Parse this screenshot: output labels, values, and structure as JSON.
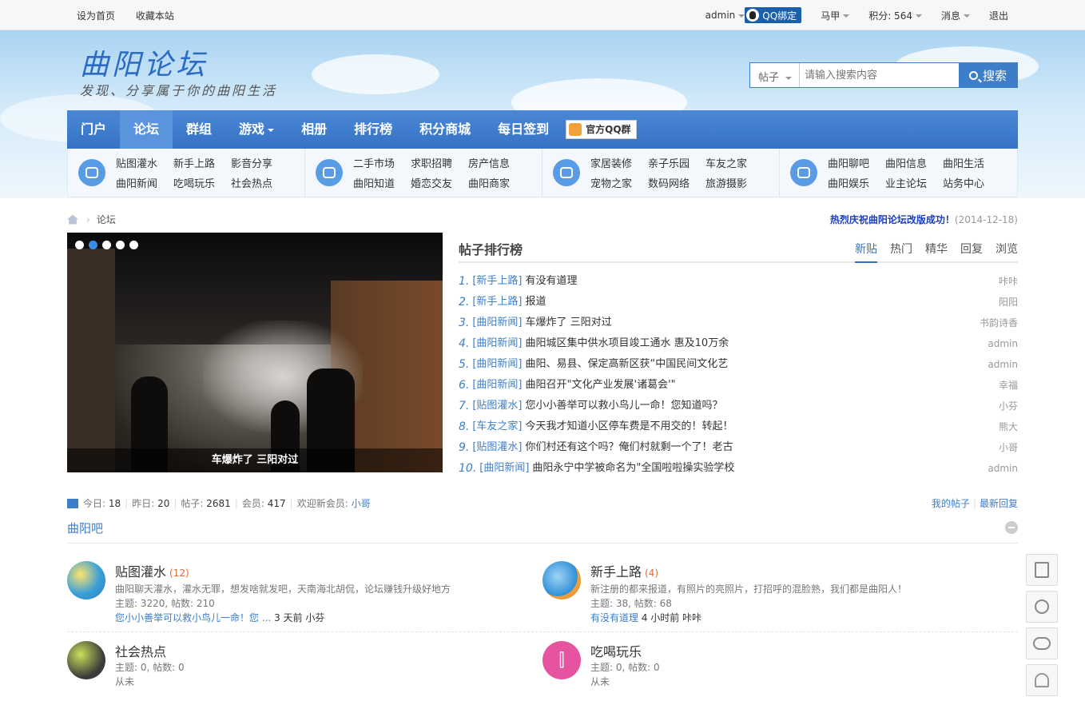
{
  "topbar": {
    "set_home": "设为首页",
    "bookmark": "收藏本站",
    "user": "admin",
    "qq_bind": "QQ绑定",
    "user_name": "马甲",
    "points": "积分: 564",
    "messages": "消息",
    "logout": "退出"
  },
  "header": {
    "logo": "曲阳论坛",
    "slogan": "发现、分享属于你的曲阳生活",
    "search_type": "帖子",
    "search_placeholder": "请输入搜索内容",
    "search_button": "搜索"
  },
  "nav": {
    "items": [
      "门户",
      "论坛",
      "群组",
      "游戏",
      "相册",
      "排行榜",
      "积分商城",
      "每日签到"
    ],
    "qq_group": "官方QQ群",
    "active": "论坛"
  },
  "subnav": [
    {
      "icon": "chat-icon",
      "links": [
        "贴图灌水",
        "新手上路",
        "影音分享",
        "曲阳新闻",
        "吃喝玩乐",
        "社会热点"
      ]
    },
    {
      "icon": "home-icon",
      "links": [
        "二手市场",
        "求职招聘",
        "房产信息",
        "曲阳知道",
        "婚恋交友",
        "曲阳商家"
      ]
    },
    {
      "icon": "tablet-icon",
      "links": [
        "家居装修",
        "亲子乐园",
        "车友之家",
        "宠物之家",
        "数码网络",
        "旅游摄影"
      ]
    },
    {
      "icon": "star-icon",
      "links": [
        "曲阳聊吧",
        "曲阳信息",
        "曲阳生活",
        "曲阳娱乐",
        "业主论坛",
        "站务中心"
      ]
    }
  ],
  "breadcrumb": {
    "current": "论坛"
  },
  "notice": {
    "text": "热烈庆祝曲阳论坛改版成功！",
    "date": "(2014-12-18)"
  },
  "slider": {
    "caption": "车爆炸了 三阳对过",
    "dot_count": 5,
    "active_dot": 2
  },
  "rank": {
    "title": "帖子排行榜",
    "tabs": [
      "新贴",
      "热门",
      "精华",
      "回复",
      "浏览"
    ],
    "active_tab": "新贴",
    "items": [
      {
        "num": "1.",
        "cat": "[新手上路]",
        "title": "有没有道理",
        "author": "咔咔"
      },
      {
        "num": "2.",
        "cat": "[新手上路]",
        "title": "报道",
        "author": "阳阳"
      },
      {
        "num": "3.",
        "cat": "[曲阳新闻]",
        "title": "车爆炸了 三阳对过",
        "author": "书韵诗香"
      },
      {
        "num": "4.",
        "cat": "[曲阳新闻]",
        "title": "曲阳城区集中供水项目竣工通水 惠及10万余",
        "author": "admin"
      },
      {
        "num": "5.",
        "cat": "[曲阳新闻]",
        "title": "曲阳、易县、保定高新区获“中国民间文化艺",
        "author": "admin"
      },
      {
        "num": "6.",
        "cat": "[曲阳新闻]",
        "title": "曲阳召开\"文化产业发展'诸葛会'\"",
        "author": "幸福"
      },
      {
        "num": "7.",
        "cat": "[贴图灌水]",
        "title": "您小小善举可以救小鸟儿一命！您知道吗？",
        "author": "小芬"
      },
      {
        "num": "8.",
        "cat": "[车友之家]",
        "title": "今天我才知道小区停车费是不用交的！转起！",
        "author": "熊大"
      },
      {
        "num": "9.",
        "cat": "[贴图灌水]",
        "title": "你们村还有这个吗？俺们村就剩一个了！老古",
        "author": "小哥"
      },
      {
        "num": "10.",
        "cat": "[曲阳新闻]",
        "title": "曲阳永宁中学被命名为\"全国啦啦操实验学校",
        "author": "admin"
      }
    ]
  },
  "stats": {
    "today_label": "今日:",
    "today": "18",
    "yesterday_label": "昨日:",
    "yesterday": "20",
    "posts_label": "帖子:",
    "posts": "2681",
    "members_label": "会员:",
    "members": "417",
    "welcome_label": "欢迎新会员:",
    "newest": "小哥"
  },
  "mylinks": {
    "my_posts": "我的帖子",
    "latest": "最新回复"
  },
  "section": {
    "title": "曲阳吧"
  },
  "forums": [
    {
      "name": "贴图灌水",
      "today": "(12)",
      "desc": "曲阳聊天灌水，灌水无罪，想发啥就发吧，天南海北胡侃，论坛赚钱升级好地方",
      "stats": "主题: 3220, 帖数: 210",
      "last_title": "您小小善举可以救小鸟儿一命！您 ...",
      "last_time": " 3 天前 小芬",
      "icon": "chat-bubbles-icon"
    },
    {
      "name": "新手上路",
      "today": "(4)",
      "desc": "新注册的都来报道，有照片的亮照片，打招呼的混脸熟，我们都是曲阳人！",
      "stats": "主题: 38, 帖数: 68",
      "last_title": "有没有道理",
      "last_time": " 4 小时前 咔咔",
      "icon": "speech-bubbles-icon"
    },
    {
      "name": "社会热点",
      "today": "",
      "desc": "",
      "stats": "主题: 0, 帖数: 0",
      "last_title": "",
      "last_time": "从未",
      "icon": "globe-icon"
    },
    {
      "name": "吃喝玩乐",
      "today": "",
      "desc": "",
      "stats": "主题: 0, 帖数: 0",
      "last_title": "",
      "last_time": "从未",
      "icon": "fork-knife-icon"
    }
  ],
  "sidebar_tools": [
    "document-icon",
    "share-icon",
    "wechat-icon",
    "user-icon"
  ]
}
